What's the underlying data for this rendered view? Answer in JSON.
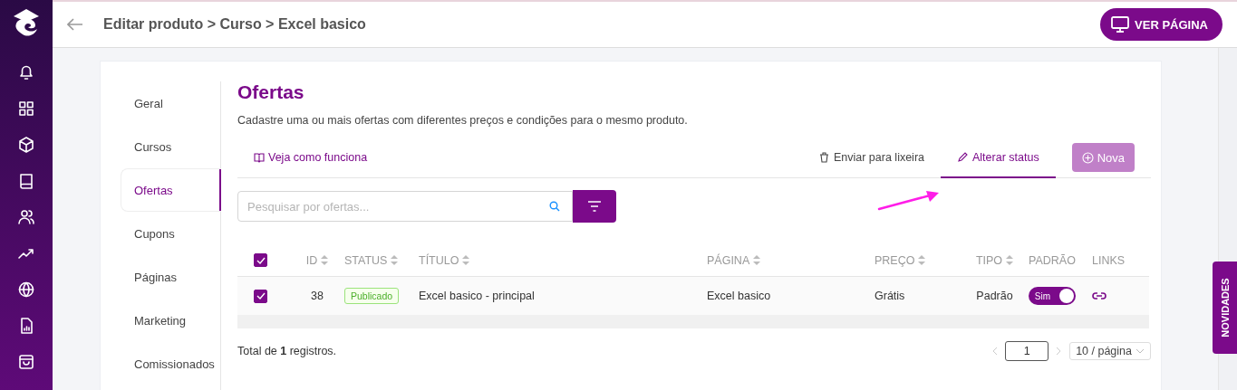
{
  "breadcrumb": "Editar produto > Curso > Excel basico",
  "view_button": "VER PÁGINA",
  "rail": [
    {
      "kind": "bell"
    },
    {
      "kind": "grid"
    },
    {
      "kind": "box"
    },
    {
      "kind": "book"
    },
    {
      "kind": "users"
    },
    {
      "kind": "trend"
    },
    {
      "kind": "globe"
    },
    {
      "kind": "report"
    },
    {
      "kind": "bag"
    }
  ],
  "side_nav": [
    {
      "label": "Geral",
      "selected": false
    },
    {
      "label": "Cursos",
      "selected": false
    },
    {
      "label": "Ofertas",
      "selected": true
    },
    {
      "label": "Cupons",
      "selected": false
    },
    {
      "label": "Páginas",
      "selected": false
    },
    {
      "label": "Marketing",
      "selected": false
    },
    {
      "label": "Comissionados",
      "selected": false
    }
  ],
  "section": {
    "title": "Ofertas",
    "description": "Cadastre uma ou mais ofertas com diferentes preços e condições para o mesmo produto."
  },
  "help_link": "Veja como funciona",
  "actions": [
    {
      "kind": "trash",
      "label": "Enviar para lixeira",
      "selected": false
    },
    {
      "kind": "edit",
      "label": "Alterar status",
      "selected": true
    }
  ],
  "new_button": {
    "label": "Nova",
    "disabled": true
  },
  "search": {
    "placeholder": "Pesquisar por ofertas..."
  },
  "table": {
    "all_checked": true,
    "columns": [
      {
        "label": "ID",
        "sortable": true
      },
      {
        "label": "STATUS",
        "sortable": true
      },
      {
        "label": "TÍTULO",
        "sortable": true
      },
      {
        "label": "PÁGINA",
        "sortable": true
      },
      {
        "label": "PREÇO",
        "sortable": true
      },
      {
        "label": "TIPO",
        "sortable": true
      },
      {
        "label": "PADRÃO",
        "sortable": false
      },
      {
        "label": "LINKS",
        "sortable": false
      }
    ],
    "rows": [
      {
        "checked": true,
        "id": "38",
        "status": "Publicado",
        "title": "Excel basico - principal",
        "page": "Excel basico",
        "price": "Grátis",
        "type": "Padrão",
        "default": {
          "label": "Sim",
          "on": true
        }
      }
    ]
  },
  "total": "Total de **1** registros.",
  "pagination": {
    "page": "1",
    "page_size": "10 / página"
  },
  "novidades": "NOVIDADES"
}
